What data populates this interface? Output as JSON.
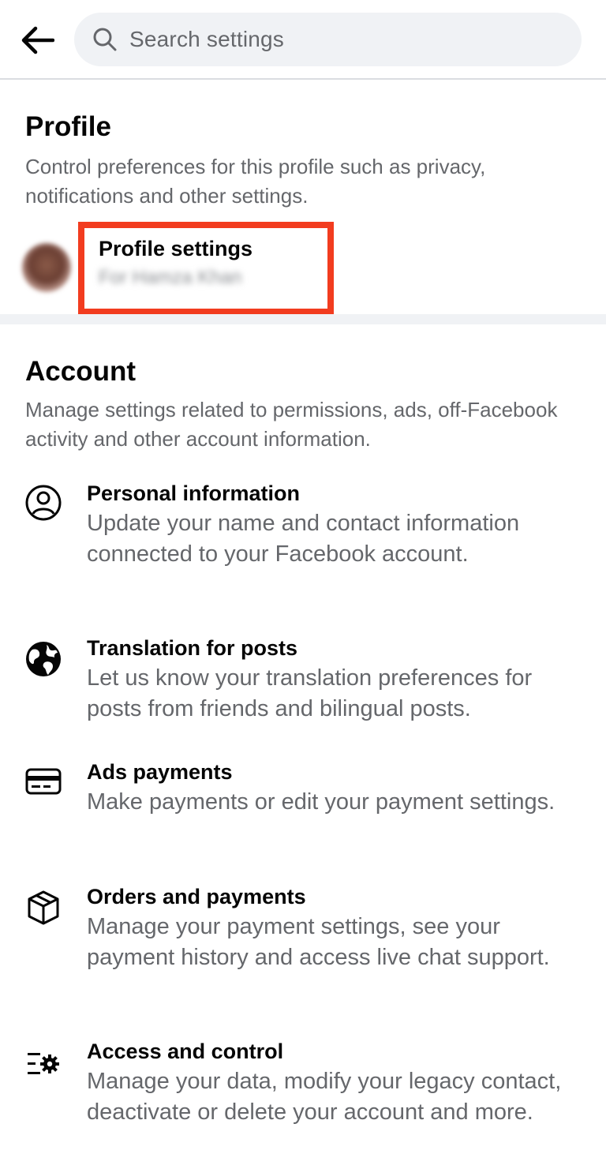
{
  "header": {
    "back_icon": "arrow-left-icon",
    "search_placeholder": "Search settings",
    "search_icon": "search-icon"
  },
  "profile": {
    "title": "Profile",
    "description": "Control preferences for this profile such as privacy, notifications and other settings.",
    "settings_label": "Profile settings",
    "settings_sub": "For Hamza Khan",
    "highlight_color": "#f23c1f"
  },
  "account": {
    "title": "Account",
    "description": "Manage settings related to permissions, ads, off-Facebook activity and other account information.",
    "items": [
      {
        "icon": "user-circle-icon",
        "title": "Personal information",
        "description": "Update your name and contact information connected to your Facebook account."
      },
      {
        "icon": "globe-icon",
        "title": "Translation for posts",
        "description": "Let us know your translation preferences for posts from friends and bilingual posts."
      },
      {
        "icon": "credit-card-icon",
        "title": "Ads payments",
        "description": "Make payments or edit your payment settings."
      },
      {
        "icon": "package-icon",
        "title": "Orders and payments",
        "description": "Manage your payment settings, see your payment history and access live chat support."
      },
      {
        "icon": "settings-list-gear-icon",
        "title": "Access and control",
        "description": "Manage your data, modify your legacy contact, deactivate or delete your account and more."
      }
    ]
  },
  "colors": {
    "primary_text": "#050505",
    "secondary_text": "#65676b",
    "search_bg": "#f0f2f5",
    "accent_highlight": "#f23c1f"
  }
}
